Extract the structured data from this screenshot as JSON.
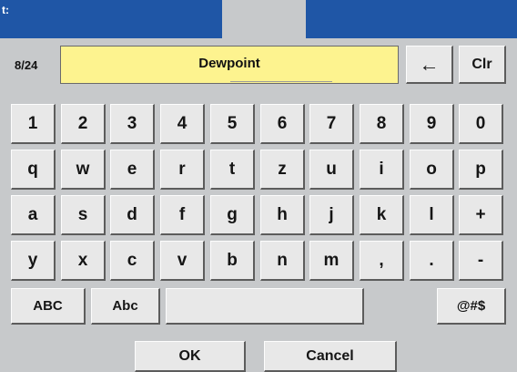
{
  "window": {
    "title": "t:"
  },
  "input": {
    "counter": "8/24",
    "value": "Dewpoint"
  },
  "actions": {
    "backspace": "←",
    "clear": "Clr",
    "ok": "OK",
    "cancel": "Cancel"
  },
  "keyboard": {
    "row1": [
      "1",
      "2",
      "3",
      "4",
      "5",
      "6",
      "7",
      "8",
      "9",
      "0"
    ],
    "row2": [
      "q",
      "w",
      "e",
      "r",
      "t",
      "z",
      "u",
      "i",
      "o",
      "p"
    ],
    "row3": [
      "a",
      "s",
      "d",
      "f",
      "g",
      "h",
      "j",
      "k",
      "l",
      "+"
    ],
    "row4": [
      "y",
      "x",
      "c",
      "v",
      "b",
      "n",
      "m",
      ",",
      ".",
      "-"
    ],
    "modes": {
      "upper": "ABC",
      "capital": "Abc",
      "symbols": "@#$"
    }
  }
}
